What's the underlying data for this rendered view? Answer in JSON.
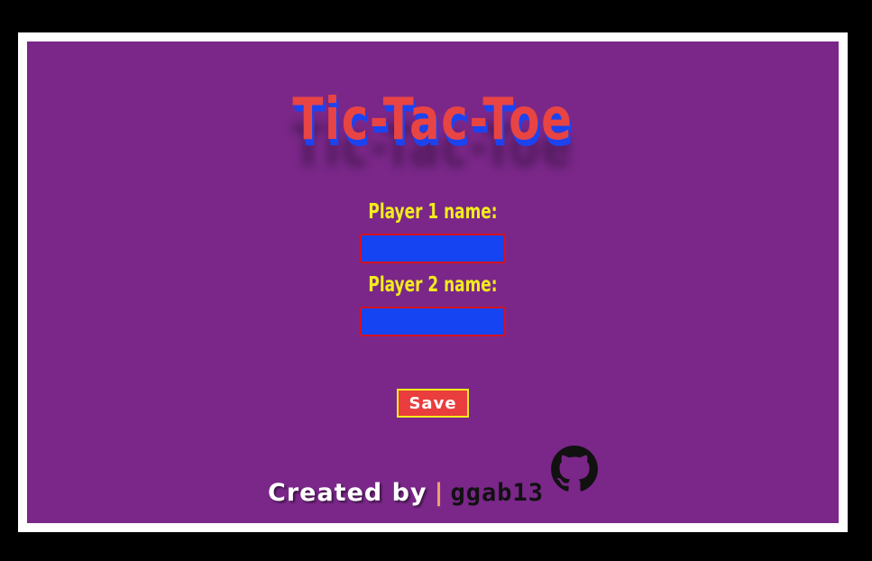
{
  "title": "Tic-Tac-Toe",
  "form": {
    "player1_label": "Player 1 name:",
    "player1_value": "",
    "player2_label": "Player 2 name:",
    "player2_value": "",
    "save_label": "Save"
  },
  "footer": {
    "created_by": "Created by",
    "separator": "|",
    "author": "ggab13",
    "github_icon": "github-icon"
  },
  "colors": {
    "background": "#7a2789",
    "title_red": "#e84444",
    "title_shadow_blue": "#1c43f0",
    "label_yellow": "#f2ec1c",
    "input_blue": "#1545f2",
    "input_border_red": "#d6121f",
    "button_red": "#ea3d3d"
  }
}
